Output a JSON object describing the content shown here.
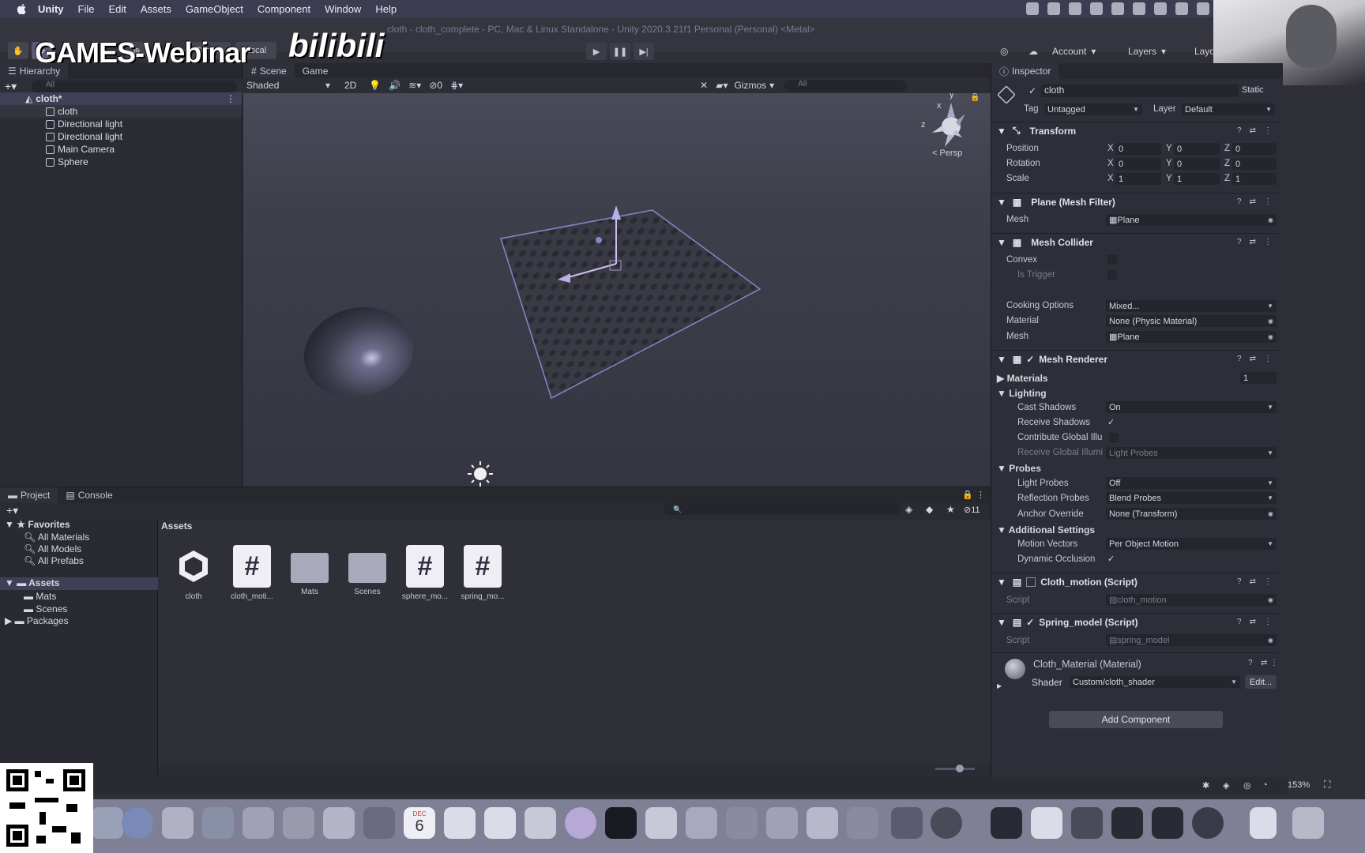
{
  "menubar": {
    "items": [
      "Unity",
      "File",
      "Edit",
      "Assets",
      "GameObject",
      "Component",
      "Window",
      "Help"
    ]
  },
  "window_title": "cloth - cloth_complete - PC, Mac & Linux Standalone - Unity 2020.3.21f1 Personal (Personal) <Metal>",
  "watermark": {
    "text": "GAMES-Webinar",
    "brand": "bilibili"
  },
  "toolbar": {
    "pivot": "Center",
    "space": "Local",
    "account": "Account",
    "layers": "Layers",
    "layout": "Layo"
  },
  "hierarchy": {
    "tab": "Hierarchy",
    "search_placeholder": "All",
    "scene_name": "cloth*",
    "objects": [
      "cloth",
      "Directional light",
      "Directional light",
      "Main Camera",
      "Sphere"
    ]
  },
  "scene_view": {
    "tabs": [
      "Scene",
      "Game"
    ],
    "shading": "Shaded",
    "mode_2d": "2D",
    "hidden_count": "0",
    "gizmos": "Gizmos",
    "search_placeholder": "All",
    "projection": "< Persp",
    "axis_labels": {
      "y": "y",
      "x": "x",
      "z": "z"
    }
  },
  "inspector": {
    "tab": "Inspector",
    "object_name": "cloth",
    "static": "Static",
    "tag_label": "Tag",
    "tag": "Untagged",
    "layer_label": "Layer",
    "layer": "Default",
    "transform": {
      "title": "Transform",
      "position": {
        "label": "Position",
        "x": "0",
        "y": "0",
        "z": "0"
      },
      "rotation": {
        "label": "Rotation",
        "x": "0",
        "y": "0",
        "z": "0"
      },
      "scale": {
        "label": "Scale",
        "x": "1",
        "y": "1",
        "z": "1"
      }
    },
    "mesh_filter": {
      "title": "Plane (Mesh Filter)",
      "mesh_label": "Mesh",
      "mesh": "Plane"
    },
    "mesh_collider": {
      "title": "Mesh Collider",
      "convex": "Convex",
      "is_trigger": "Is Trigger",
      "cooking_label": "Cooking Options",
      "cooking": "Mixed...",
      "material_label": "Material",
      "material": "None (Physic Material)",
      "mesh_label": "Mesh",
      "mesh": "Plane"
    },
    "mesh_renderer": {
      "title": "Mesh Renderer",
      "materials_label": "Materials",
      "materials_count": "1",
      "lighting": "Lighting",
      "cast_shadows_label": "Cast Shadows",
      "cast_shadows": "On",
      "receive_shadows": "Receive Shadows",
      "contribute_gi": "Contribute Global Illu",
      "receive_gi_label": "Receive Global Illumi",
      "receive_gi": "Light Probes",
      "probes": "Probes",
      "light_probes_label": "Light Probes",
      "light_probes": "Off",
      "reflection_probes_label": "Reflection Probes",
      "reflection_probes": "Blend Probes",
      "anchor_label": "Anchor Override",
      "anchor": "None (Transform)",
      "additional": "Additional Settings",
      "motion_vectors_label": "Motion Vectors",
      "motion_vectors": "Per Object Motion",
      "dynamic_occlusion": "Dynamic Occlusion"
    },
    "cloth_motion": {
      "title": "Cloth_motion (Script)",
      "script_label": "Script",
      "script": "cloth_motion"
    },
    "spring_model": {
      "title": "Spring_model (Script)",
      "script_label": "Script",
      "script": "spring_model"
    },
    "material": {
      "title": "Cloth_Material (Material)",
      "shader_label": "Shader",
      "shader": "Custom/cloth_shader",
      "edit": "Edit..."
    },
    "add_component": "Add Component"
  },
  "project": {
    "tabs": [
      "Project",
      "Console"
    ],
    "hidden_count": "11",
    "favorites": "Favorites",
    "favorite_items": [
      "All Materials",
      "All Models",
      "All Prefabs"
    ],
    "assets_root": "Assets",
    "asset_folders": [
      "Mats",
      "Scenes"
    ],
    "packages": "Packages",
    "breadcrumb": "Assets",
    "assets": [
      {
        "name": "cloth",
        "kind": "unity-scene-icon"
      },
      {
        "name": "cloth_moti...",
        "kind": "script-icon"
      },
      {
        "name": "Mats",
        "kind": "folder-icon"
      },
      {
        "name": "Scenes",
        "kind": "folder-icon"
      },
      {
        "name": "sphere_mo...",
        "kind": "script-icon"
      },
      {
        "name": "spring_mo...",
        "kind": "script-icon"
      }
    ]
  },
  "status": {
    "zoom": "153%"
  },
  "dock": {
    "calendar_month": "DEC",
    "calendar_day": "6"
  },
  "colors": {
    "accent": "#3f4055",
    "panel": "#2b2b33",
    "dock": "#7f7f95"
  }
}
